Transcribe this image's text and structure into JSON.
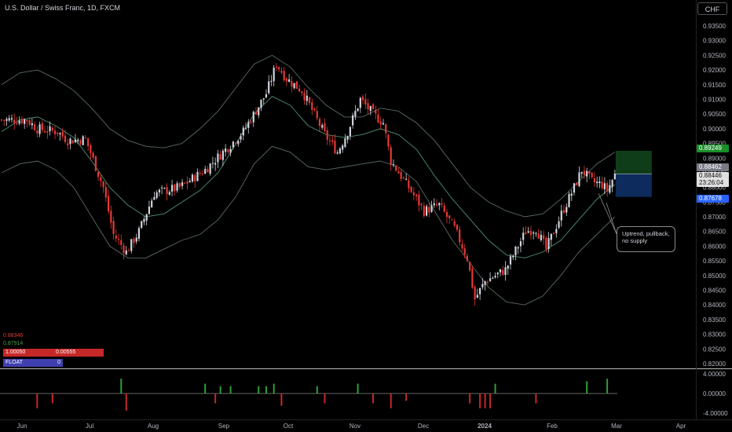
{
  "header": {
    "title": "U.S. Dollar / Swiss Franc, 1D, FXCM",
    "currency_button": "CHF"
  },
  "stats": {
    "red_value": "0.88346",
    "green_value": "0.87914",
    "box1_left": "1.00050",
    "box1_right": "0.00555",
    "box2_left": "FLOAT",
    "box2_right": "0"
  },
  "annotation": {
    "text": "Uptrend, pullback, no supply"
  },
  "price_tags": {
    "green_tag": "0.89249",
    "grey_tag": "0.88462",
    "current_price": "0.88446",
    "countdown": "23:26:04",
    "blue_tag": "0.87678"
  },
  "colors": {
    "up_candle": "#d1d4dc",
    "down_candle": "#e53935",
    "band_line": "#5a6b61",
    "mid_line": "#4f8f73",
    "target_zone": "#0f3d1a",
    "stop_zone": "#0d2b5c",
    "green_tag": "#1a8f28",
    "blue_tag": "#2962ff",
    "grey_tag": "#787b86"
  },
  "chart_data": {
    "type": "candlestick",
    "title": "U.S. Dollar / Swiss Franc, 1D, FXCM",
    "x_labels": [
      "Jun",
      "Jul",
      "Aug",
      "Sep",
      "Oct",
      "Nov",
      "Dec",
      "2024",
      "Feb",
      "Mar",
      "Apr"
    ],
    "y_ticks": [
      "0.93500",
      "0.93000",
      "0.92500",
      "0.92000",
      "0.91500",
      "0.91000",
      "0.90500",
      "0.90000",
      "0.89500",
      "0.89000",
      "0.88500",
      "0.88000",
      "0.87500",
      "0.87000",
      "0.86500",
      "0.86000",
      "0.85500",
      "0.85000",
      "0.84500",
      "0.84000",
      "0.83500",
      "0.83000",
      "0.82500",
      "0.82000"
    ],
    "ylim": [
      0.8195,
      0.9395
    ],
    "anchors": [
      {
        "x": 0,
        "y": 0.903
      },
      {
        "x": 10,
        "y": 0.903
      },
      {
        "x": 14,
        "y": 0.9
      },
      {
        "x": 22,
        "y": 0.899
      },
      {
        "x": 26,
        "y": 0.896
      },
      {
        "x": 33,
        "y": 0.8965
      },
      {
        "x": 40,
        "y": 0.88
      },
      {
        "x": 44,
        "y": 0.864
      },
      {
        "x": 49,
        "y": 0.858
      },
      {
        "x": 54,
        "y": 0.865
      },
      {
        "x": 60,
        "y": 0.878
      },
      {
        "x": 70,
        "y": 0.88
      },
      {
        "x": 80,
        "y": 0.886
      },
      {
        "x": 95,
        "y": 0.899
      },
      {
        "x": 104,
        "y": 0.912
      },
      {
        "x": 108,
        "y": 0.922
      },
      {
        "x": 112,
        "y": 0.917
      },
      {
        "x": 118,
        "y": 0.913
      },
      {
        "x": 127,
        "y": 0.898
      },
      {
        "x": 132,
        "y": 0.892
      },
      {
        "x": 136,
        "y": 0.899
      },
      {
        "x": 141,
        "y": 0.91
      },
      {
        "x": 146,
        "y": 0.905
      },
      {
        "x": 150,
        "y": 0.902
      },
      {
        "x": 153,
        "y": 0.889
      },
      {
        "x": 160,
        "y": 0.88
      },
      {
        "x": 166,
        "y": 0.872
      },
      {
        "x": 172,
        "y": 0.874
      },
      {
        "x": 178,
        "y": 0.866
      },
      {
        "x": 183,
        "y": 0.856
      },
      {
        "x": 186,
        "y": 0.842
      },
      {
        "x": 190,
        "y": 0.848
      },
      {
        "x": 198,
        "y": 0.852
      },
      {
        "x": 206,
        "y": 0.865
      },
      {
        "x": 210,
        "y": 0.866
      },
      {
        "x": 214,
        "y": 0.859
      },
      {
        "x": 220,
        "y": 0.871
      },
      {
        "x": 225,
        "y": 0.88
      },
      {
        "x": 228,
        "y": 0.886
      },
      {
        "x": 232,
        "y": 0.882
      },
      {
        "x": 236,
        "y": 0.881
      },
      {
        "x": 238,
        "y": 0.879
      },
      {
        "x": 241,
        "y": 0.8844
      }
    ],
    "bands": {
      "upper": [
        0.915,
        0.919,
        0.92,
        0.917,
        0.913,
        0.907,
        0.9,
        0.896,
        0.894,
        0.8935,
        0.895,
        0.9,
        0.906,
        0.914,
        0.922,
        0.925,
        0.921,
        0.914,
        0.908,
        0.904,
        0.904,
        0.907,
        0.906,
        0.902,
        0.896,
        0.888,
        0.88,
        0.875,
        0.872,
        0.87,
        0.871,
        0.876,
        0.882,
        0.888,
        0.892
      ],
      "middle": [
        0.899,
        0.903,
        0.904,
        0.901,
        0.897,
        0.889,
        0.88,
        0.874,
        0.87,
        0.871,
        0.875,
        0.879,
        0.885,
        0.895,
        0.905,
        0.911,
        0.908,
        0.901,
        0.898,
        0.897,
        0.898,
        0.9,
        0.898,
        0.893,
        0.884,
        0.876,
        0.869,
        0.862,
        0.857,
        0.856,
        0.858,
        0.862,
        0.869,
        0.876,
        0.881
      ],
      "lower": [
        0.885,
        0.888,
        0.889,
        0.886,
        0.88,
        0.87,
        0.86,
        0.856,
        0.856,
        0.859,
        0.862,
        0.864,
        0.869,
        0.877,
        0.888,
        0.894,
        0.892,
        0.887,
        0.886,
        0.887,
        0.888,
        0.889,
        0.887,
        0.882,
        0.872,
        0.862,
        0.854,
        0.846,
        0.841,
        0.84,
        0.843,
        0.85,
        0.858,
        0.864,
        0.87
      ]
    },
    "position": {
      "entry": 0.88462,
      "target": 0.89249,
      "stop": 0.87678
    },
    "sub_panel": {
      "y_ticks": [
        "4.00000",
        "0.00000",
        "-4.00000"
      ],
      "ylim": [
        -4.8,
        4.8
      ],
      "bars": [
        {
          "x": 14,
          "v": -3
        },
        {
          "x": 20,
          "v": -2
        },
        {
          "x": 47,
          "v": 3
        },
        {
          "x": 49,
          "v": -3.5
        },
        {
          "x": 80,
          "v": 2
        },
        {
          "x": 84,
          "v": -2
        },
        {
          "x": 86,
          "v": 1.5
        },
        {
          "x": 90,
          "v": 1.5
        },
        {
          "x": 101,
          "v": 1.5
        },
        {
          "x": 104,
          "v": 1.5
        },
        {
          "x": 107,
          "v": 2
        },
        {
          "x": 110,
          "v": -2.5
        },
        {
          "x": 124,
          "v": 1.5
        },
        {
          "x": 127,
          "v": -2
        },
        {
          "x": 140,
          "v": 2
        },
        {
          "x": 146,
          "v": -2
        },
        {
          "x": 153,
          "v": -3
        },
        {
          "x": 159,
          "v": -1.5
        },
        {
          "x": 184,
          "v": -2
        },
        {
          "x": 188,
          "v": -3
        },
        {
          "x": 190,
          "v": -3
        },
        {
          "x": 192,
          "v": -3
        },
        {
          "x": 194,
          "v": 2
        },
        {
          "x": 210,
          "v": -2
        },
        {
          "x": 230,
          "v": 2.5
        },
        {
          "x": 238,
          "v": 3
        }
      ]
    }
  }
}
